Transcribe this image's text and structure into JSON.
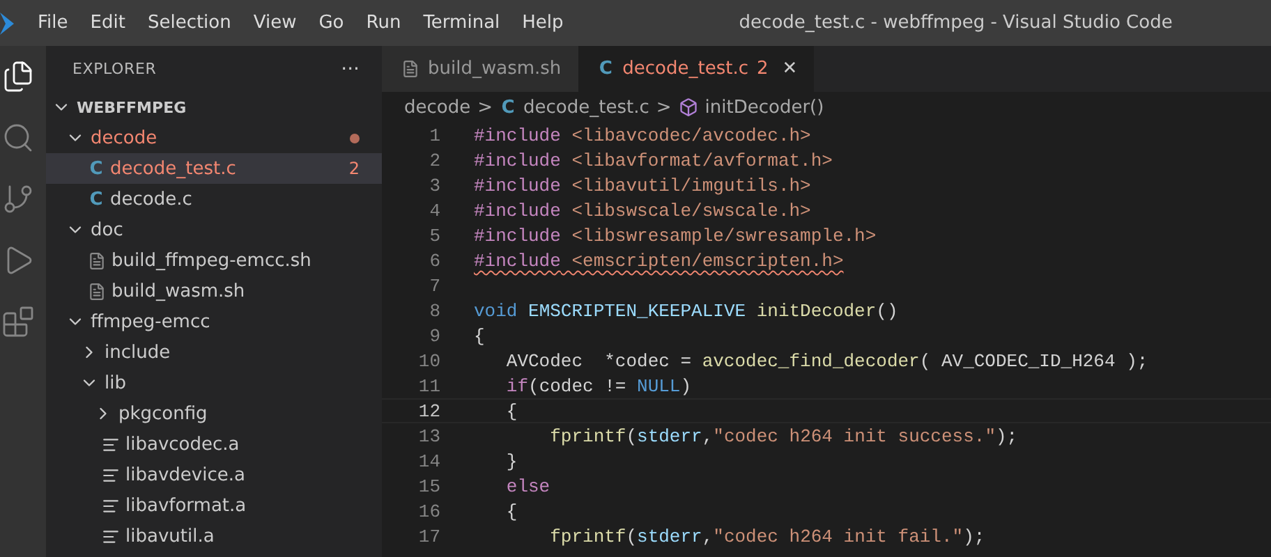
{
  "menu": [
    "File",
    "Edit",
    "Selection",
    "View",
    "Go",
    "Run",
    "Terminal",
    "Help"
  ],
  "window": {
    "title": "decode_test.c - webffmpeg - Visual Studio Code"
  },
  "activity_bar": [
    {
      "kind": "files",
      "selected": true
    },
    {
      "kind": "search",
      "selected": false
    },
    {
      "kind": "source-control",
      "selected": false
    },
    {
      "kind": "run",
      "selected": false
    },
    {
      "kind": "extensions",
      "selected": false
    }
  ],
  "sidebar": {
    "title": "EXPLORER",
    "more": "···",
    "root": {
      "label": "WEBFFMPEG",
      "expanded": true
    },
    "tree": [
      {
        "label": "decode",
        "kind": "folder",
        "expanded": true,
        "has_errors": true,
        "modified_dot": true,
        "selected": false,
        "children": [
          {
            "label": "decode_test.c",
            "kind": "c",
            "glyph": "C",
            "has_errors": true,
            "problems": "2",
            "selected": true
          },
          {
            "label": "decode.c",
            "kind": "c",
            "glyph": "C",
            "has_errors": false,
            "selected": false
          }
        ]
      },
      {
        "label": "doc",
        "kind": "folder",
        "expanded": true,
        "has_errors": false,
        "selected": false,
        "children": [
          {
            "label": "build_ffmpeg-emcc.sh",
            "kind": "shell",
            "has_errors": false,
            "selected": false
          },
          {
            "label": "build_wasm.sh",
            "kind": "shell",
            "has_errors": false,
            "selected": false
          }
        ]
      },
      {
        "label": "ffmpeg-emcc",
        "kind": "folder",
        "expanded": true,
        "has_errors": false,
        "selected": false,
        "children": [
          {
            "label": "include",
            "kind": "folder",
            "expanded": false,
            "has_errors": false,
            "selected": false
          },
          {
            "label": "lib",
            "kind": "folder",
            "expanded": true,
            "has_errors": false,
            "selected": false,
            "children": [
              {
                "label": "pkgconfig",
                "kind": "folder",
                "expanded": false,
                "has_errors": false,
                "selected": false
              },
              {
                "label": "libavcodec.a",
                "kind": "archive",
                "has_errors": false,
                "selected": false
              },
              {
                "label": "libavdevice.a",
                "kind": "archive",
                "has_errors": false,
                "selected": false
              },
              {
                "label": "libavformat.a",
                "kind": "archive",
                "has_errors": false,
                "selected": false
              },
              {
                "label": "libavutil.a",
                "kind": "archive",
                "has_errors": false,
                "selected": false
              }
            ]
          }
        ]
      }
    ]
  },
  "tabs": [
    {
      "label": "build_wasm.sh",
      "kind": "shell",
      "selected": false,
      "has_errors": false
    },
    {
      "label": "decode_test.c",
      "kind": "c",
      "glyph": "C",
      "problems": "2",
      "close": "✕",
      "selected": true,
      "has_errors": true
    }
  ],
  "breadcrumbs": [
    {
      "label": "decode",
      "kind": "folder"
    },
    {
      "label": "decode_test.c",
      "kind": "c",
      "glyph": "C"
    },
    {
      "label": "initDecoder()",
      "kind": "function"
    }
  ],
  "breadcrumb_separator": ">",
  "code": [
    {
      "number": "1",
      "selected": false,
      "tokens": [
        {
          "text": "#include",
          "kind": "directive"
        },
        {
          "text": " <libavcodec/avcodec.h>",
          "kind": "string"
        }
      ]
    },
    {
      "number": "2",
      "selected": false,
      "tokens": [
        {
          "text": "#include",
          "kind": "directive"
        },
        {
          "text": " <libavformat/avformat.h>",
          "kind": "string"
        }
      ]
    },
    {
      "number": "3",
      "selected": false,
      "tokens": [
        {
          "text": "#include",
          "kind": "directive"
        },
        {
          "text": " <libavutil/imgutils.h>",
          "kind": "string"
        }
      ]
    },
    {
      "number": "4",
      "selected": false,
      "tokens": [
        {
          "text": "#include",
          "kind": "directive"
        },
        {
          "text": " <libswscale/swscale.h>",
          "kind": "string"
        }
      ]
    },
    {
      "number": "5",
      "selected": false,
      "tokens": [
        {
          "text": "#include",
          "kind": "directive"
        },
        {
          "text": " <libswresample/swresample.h>",
          "kind": "string"
        }
      ]
    },
    {
      "number": "6",
      "selected": false,
      "error": true,
      "tokens": [
        {
          "text": "#include",
          "kind": "directive"
        },
        {
          "text": " <emscripten/emscripten.h>",
          "kind": "string"
        }
      ]
    },
    {
      "number": "7",
      "selected": false
    },
    {
      "number": "8",
      "selected": false,
      "tokens": [
        {
          "text": "void",
          "kind": "keyword"
        },
        {
          "text": " EMSCRIPTEN_KEEPALIVE",
          "kind": "macro"
        },
        {
          "text": " initDecoder",
          "kind": "function"
        },
        {
          "text": "()",
          "kind": "plain"
        }
      ]
    },
    {
      "number": "9",
      "selected": false,
      "tokens": [
        {
          "text": "{",
          "kind": "plain"
        }
      ]
    },
    {
      "number": "10",
      "selected": false,
      "tokens": [
        {
          "text": "   AVCodec  *codec = ",
          "kind": "plain"
        },
        {
          "text": "avcodec_find_decoder",
          "kind": "function"
        },
        {
          "text": "( AV_CODEC_ID_H264 );",
          "kind": "plain"
        }
      ]
    },
    {
      "number": "11",
      "selected": false,
      "tokens": [
        {
          "text": "   if",
          "kind": "control"
        },
        {
          "text": "(codec != ",
          "kind": "plain"
        },
        {
          "text": "NULL",
          "kind": "keyword"
        },
        {
          "text": ")",
          "kind": "plain"
        }
      ]
    },
    {
      "number": "12",
      "selected": true,
      "tokens": [
        {
          "text": "   {",
          "kind": "plain"
        }
      ]
    },
    {
      "number": "13",
      "selected": false,
      "tokens": [
        {
          "text": "       fprintf",
          "kind": "function"
        },
        {
          "text": "(",
          "kind": "plain"
        },
        {
          "text": "stderr",
          "kind": "variable"
        },
        {
          "text": ",",
          "kind": "plain"
        },
        {
          "text": "\"codec h264 init success.\"",
          "kind": "string"
        },
        {
          "text": ");",
          "kind": "plain"
        }
      ]
    },
    {
      "number": "14",
      "selected": false,
      "tokens": [
        {
          "text": "   }",
          "kind": "plain"
        }
      ]
    },
    {
      "number": "15",
      "selected": false,
      "tokens": [
        {
          "text": "   else",
          "kind": "control"
        }
      ]
    },
    {
      "number": "16",
      "selected": false,
      "tokens": [
        {
          "text": "   {",
          "kind": "plain"
        }
      ]
    },
    {
      "number": "17",
      "selected": false,
      "tokens": [
        {
          "text": "       fprintf",
          "kind": "function"
        },
        {
          "text": "(",
          "kind": "plain"
        },
        {
          "text": "stderr",
          "kind": "variable"
        },
        {
          "text": ",",
          "kind": "plain"
        },
        {
          "text": "\"codec h264 init fail.\"",
          "kind": "string"
        },
        {
          "text": ");",
          "kind": "plain"
        }
      ]
    }
  ]
}
